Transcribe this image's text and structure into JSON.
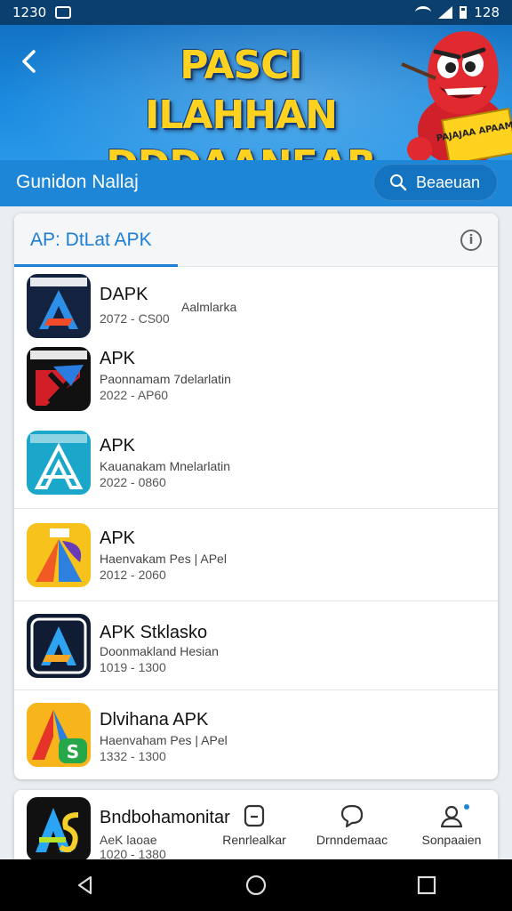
{
  "status_bar": {
    "time_left": "1230",
    "time_right": "128"
  },
  "banner": {
    "title_line1": "PASCI ILAHHAN",
    "title_line2": "DDDAANEAR",
    "sign_text": "PAJAJAA APAAMA"
  },
  "subheader": {
    "label": "Gunidon Nallaj",
    "search_label": "Beaeuan"
  },
  "list_card": {
    "title": "AP: DtLat APK",
    "items": [
      {
        "name": "DAPK",
        "side_text": "Aalmlarka",
        "subtitle": "",
        "date": "2072 - CS00",
        "icon": "apk-a-dark-icon"
      },
      {
        "name": "APK",
        "side_text": "",
        "subtitle": "Paonnamam 7delarlatin",
        "date": "2022 - AP60",
        "icon": "apk-red-x-icon"
      },
      {
        "name": "APK",
        "side_text": "",
        "subtitle": "Kauanakam Mnelarlatin",
        "date": "2022 - 0860",
        "icon": "apk-teal-a-icon"
      },
      {
        "name": "APK",
        "side_text": "",
        "subtitle": "Haenvakam Pes | APel",
        "date": "2012 - 2060",
        "icon": "apk-yellow-a-icon"
      },
      {
        "name": "APK Stklasko",
        "side_text": "",
        "subtitle": "Doonmakland Hesian",
        "date": "1019 - 1300",
        "icon": "apk-navy-a-icon"
      },
      {
        "name": "Dlvihana APK",
        "side_text": "",
        "subtitle": "Haenvaham Pes | APel",
        "date": "1332 - 1300",
        "icon": "apk-orange-s-icon"
      }
    ]
  },
  "bottom_card": {
    "app": {
      "name": "Bndbohamonitar",
      "subtitle": "AeK laoae",
      "date": "1020 - 1380",
      "icon": "apk-as-icon"
    },
    "tabs": [
      {
        "label": "Renrlealkar",
        "icon": "box-icon"
      },
      {
        "label": "Drnndemaac",
        "icon": "chat-icon"
      },
      {
        "label": "Sonpaaien",
        "icon": "person-icon"
      }
    ]
  },
  "colors": {
    "primary": "#1e86d6",
    "accent_yellow": "#ffd21f",
    "banner_dark": "#0b3f6e"
  }
}
